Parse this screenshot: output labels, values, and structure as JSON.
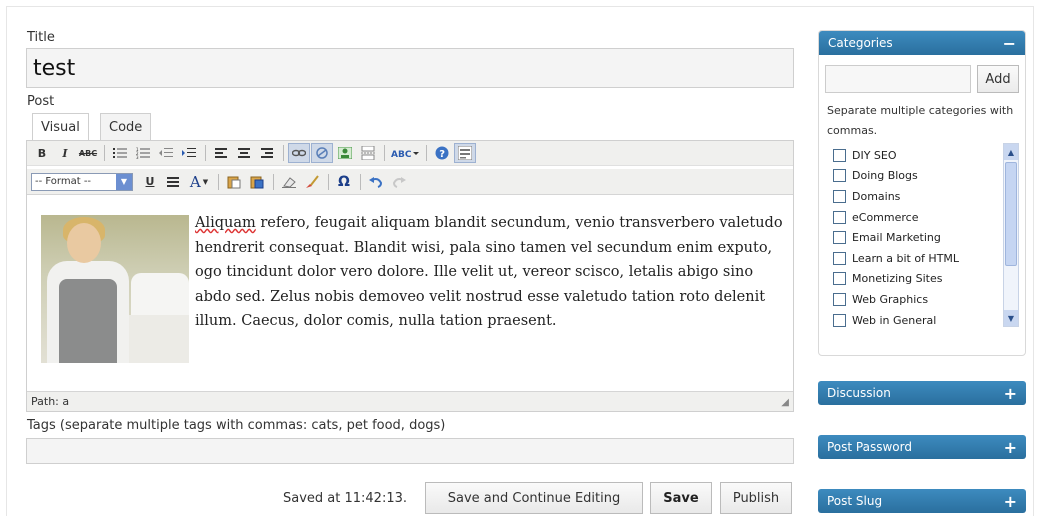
{
  "title_label": "Title",
  "title_value": "test",
  "post_label": "Post",
  "tabs": [
    {
      "label": "Visual"
    },
    {
      "label": "Code"
    }
  ],
  "toolbar": {
    "bold": "B",
    "italic": "I",
    "strike": "ABC",
    "format_select": "-- Format --",
    "underline": "U",
    "text_color": "A",
    "omega": "Ω"
  },
  "body_text": {
    "first_word": "Aliquam",
    "rest": " refero, feugait aliquam blandit secundum, venio transverbero valetudo hendrerit consequat. Blandit wisi, pala sino tamen vel secundum enim exputo, ogo tincidunt dolor vero dolore. Ille velit ut, vereor scisco, letalis abigo sino abdo sed. Zelus nobis demoveo velit nostrud esse valetudo tation roto delenit illum. Caecus, dolor comis, nulla tation praesent."
  },
  "path_text": "Path: a",
  "tags_label": "Tags (separate multiple tags with commas: cats, pet food, dogs)",
  "saved_text": "Saved at 11:42:13.",
  "buttons": {
    "save_continue": "Save and Continue Editing",
    "save": "Save",
    "publish": "Publish"
  },
  "sidebar": {
    "categories": {
      "title": "Categories",
      "toggle": "−",
      "add_label": "Add",
      "hint": "Separate multiple categories with commas.",
      "items": [
        {
          "label": "DIY SEO"
        },
        {
          "label": "Doing Blogs"
        },
        {
          "label": "Domains"
        },
        {
          "label": "eCommerce"
        },
        {
          "label": "Email Marketing"
        },
        {
          "label": "Learn a bit of HTML"
        },
        {
          "label": "Monetizing Sites"
        },
        {
          "label": "Web Graphics"
        },
        {
          "label": "Web in General"
        }
      ]
    },
    "discussion": {
      "title": "Discussion",
      "toggle": "+"
    },
    "post_password": {
      "title": "Post Password",
      "toggle": "+"
    },
    "post_slug": {
      "title": "Post Slug",
      "toggle": "+"
    }
  }
}
